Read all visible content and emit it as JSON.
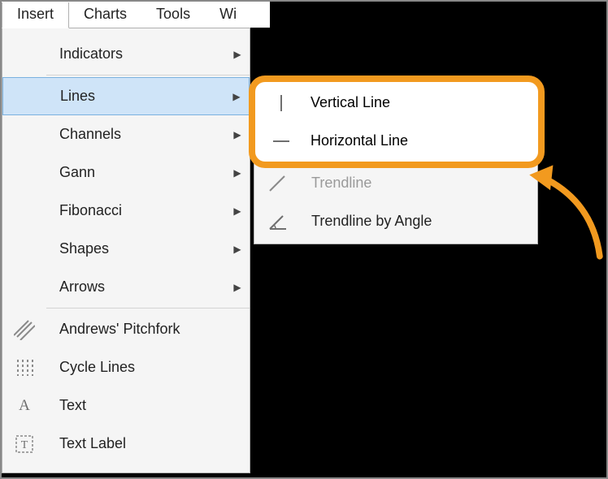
{
  "menubar": {
    "items": [
      "Insert",
      "Charts",
      "Tools",
      "Wi"
    ],
    "active_index": 0
  },
  "dropdown": {
    "items": [
      {
        "label": "Indicators",
        "has_submenu": true,
        "icon": ""
      },
      {
        "label": "Lines",
        "has_submenu": true,
        "icon": "",
        "selected": true
      },
      {
        "label": "Channels",
        "has_submenu": true,
        "icon": ""
      },
      {
        "label": "Gann",
        "has_submenu": true,
        "icon": ""
      },
      {
        "label": "Fibonacci",
        "has_submenu": true,
        "icon": ""
      },
      {
        "label": "Shapes",
        "has_submenu": true,
        "icon": ""
      },
      {
        "label": "Arrows",
        "has_submenu": true,
        "icon": ""
      },
      {
        "label": "Andrews' Pitchfork",
        "has_submenu": false,
        "icon": "pitchfork"
      },
      {
        "label": "Cycle Lines",
        "has_submenu": false,
        "icon": "cycle-lines"
      },
      {
        "label": "Text",
        "has_submenu": false,
        "icon": "text"
      },
      {
        "label": "Text Label",
        "has_submenu": false,
        "icon": "text-label"
      }
    ],
    "sep_after_indices": [
      0,
      6
    ]
  },
  "submenu": {
    "items": [
      {
        "label": "Vertical Line",
        "icon": "vertical-line"
      },
      {
        "label": "Horizontal Line",
        "icon": "horizontal-line"
      },
      {
        "label": "Trendline",
        "icon": "trendline",
        "obscured": true
      },
      {
        "label": "Trendline by Angle",
        "icon": "angle"
      }
    ]
  },
  "highlight_items": [
    {
      "label": "Vertical Line",
      "icon": "vertical-line"
    },
    {
      "label": "Horizontal Line",
      "icon": "horizontal-line"
    }
  ],
  "colors": {
    "highlight": "#f29a1f",
    "selection_bg": "#cfe4f8",
    "selection_border": "#7bb2e0"
  }
}
